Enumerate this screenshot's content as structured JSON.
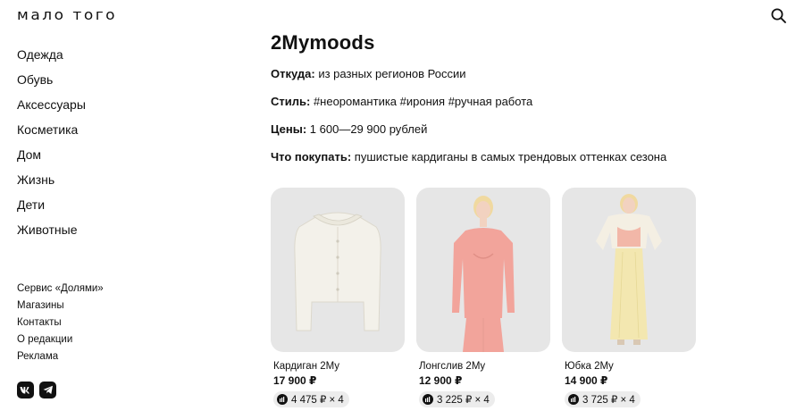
{
  "header": {
    "logo": "мало того",
    "search_icon": "search-icon"
  },
  "nav": {
    "items": [
      "Одежда",
      "Обувь",
      "Аксессуары",
      "Косметика",
      "Дом",
      "Жизнь",
      "Дети",
      "Животные"
    ]
  },
  "footer": {
    "links": [
      "Сервис «Долями»",
      "Магазины",
      "Контакты",
      "О редакции",
      "Реклама"
    ],
    "social": [
      "vk-icon",
      "telegram-icon"
    ]
  },
  "article": {
    "brand": "2Mymoods",
    "rows": [
      {
        "label": "Откуда:",
        "value": " из разных регионов России"
      },
      {
        "label": "Стиль:",
        "value": " #неоромантика #ирония #ручная работа"
      },
      {
        "label": "Цены:",
        "value": " 1 600—29 900 рублей"
      },
      {
        "label": "Что покупать:",
        "value": " пушистые кардиганы в самых трендовых оттенках сезона"
      }
    ]
  },
  "products": [
    {
      "name": "Кардиган 2My",
      "price": "17 900 ₽",
      "installment": "4 475 ₽ × 4"
    },
    {
      "name": "Лонгслив 2My",
      "price": "12 900 ₽",
      "installment": "3 225 ₽ × 4"
    },
    {
      "name": "Юбка 2My",
      "price": "14 900 ₽",
      "installment": "3 725 ₽ × 4"
    }
  ],
  "colors": {
    "text": "#111111",
    "card_bg": "#e6e6e6",
    "badge_bg": "#ececec",
    "cardigan": "#f3f1ea",
    "longsleeve": "#f2a49b",
    "skirt": "#f3e7b0"
  }
}
